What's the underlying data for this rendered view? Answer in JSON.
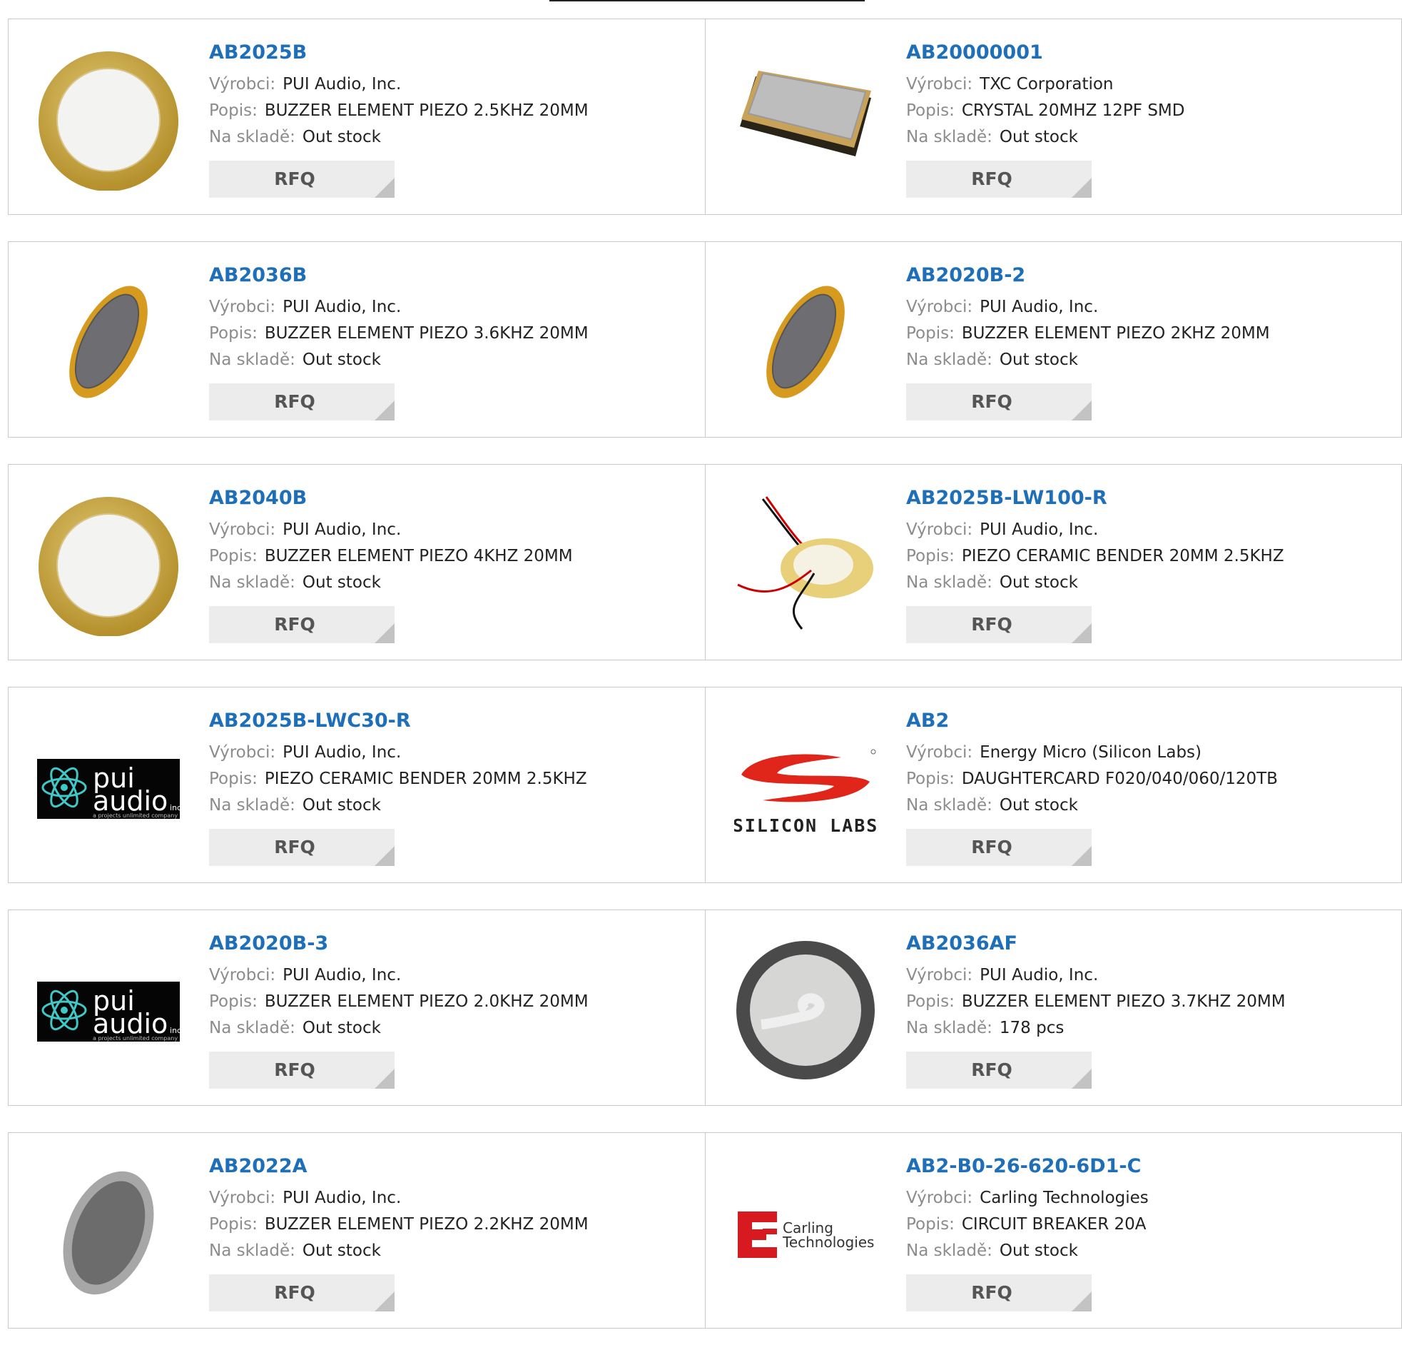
{
  "labels": {
    "maker": "Výrobci:",
    "desc": "Popis:",
    "stock": "Na skladě:",
    "rfq": "RFQ"
  },
  "products": [
    {
      "pn": "AB2025B",
      "maker": "PUI Audio, Inc.",
      "desc": "BUZZER ELEMENT PIEZO 2.5KHZ 20MM",
      "stock": "Out stock",
      "image": "piezo-disc-gold-icon"
    },
    {
      "pn": "AB20000001",
      "maker": "TXC Corporation",
      "desc": "CRYSTAL 20MHZ 12PF SMD",
      "stock": "Out stock",
      "image": "smd-crystal-icon"
    },
    {
      "pn": "AB2036B",
      "maker": "PUI Audio, Inc.",
      "desc": "BUZZER ELEMENT PIEZO 3.6KHZ 20MM",
      "stock": "Out stock",
      "image": "piezo-disc-tilted-icon"
    },
    {
      "pn": "AB2020B-2",
      "maker": "PUI Audio, Inc.",
      "desc": "BUZZER ELEMENT PIEZO 2KHZ 20MM",
      "stock": "Out stock",
      "image": "piezo-disc-tilted-icon"
    },
    {
      "pn": "AB2040B",
      "maker": "PUI Audio, Inc.",
      "desc": "BUZZER ELEMENT PIEZO 4KHZ 20MM",
      "stock": "Out stock",
      "image": "piezo-disc-gold-icon"
    },
    {
      "pn": "AB2025B-LW100-R",
      "maker": "PUI Audio, Inc.",
      "desc": "PIEZO CERAMIC BENDER 20MM 2.5KHZ",
      "stock": "Out stock",
      "image": "piezo-bender-wires-icon"
    },
    {
      "pn": "AB2025B-LWC30-R",
      "maker": "PUI Audio, Inc.",
      "desc": "PIEZO CERAMIC BENDER 20MM 2.5KHZ",
      "stock": "Out stock",
      "image": "pui-audio-logo"
    },
    {
      "pn": "AB2",
      "maker": "Energy Micro (Silicon Labs)",
      "desc": "DAUGHTERCARD F020/040/060/120TB",
      "stock": "Out stock",
      "image": "silicon-labs-logo"
    },
    {
      "pn": "AB2020B-3",
      "maker": "PUI Audio, Inc.",
      "desc": "BUZZER ELEMENT PIEZO 2.0KHZ 20MM",
      "stock": "Out stock",
      "image": "pui-audio-logo"
    },
    {
      "pn": "AB2036AF",
      "maker": "PUI Audio, Inc.",
      "desc": "BUZZER ELEMENT PIEZO 3.7KHZ 20MM",
      "stock": "178 pcs",
      "image": "piezo-disc-gray-icon"
    },
    {
      "pn": "AB2022A",
      "maker": "PUI Audio, Inc.",
      "desc": "BUZZER ELEMENT PIEZO 2.2KHZ 20MM",
      "stock": "Out stock",
      "image": "piezo-disc-silver-icon"
    },
    {
      "pn": "AB2-B0-26-620-6D1-C",
      "maker": "Carling Technologies",
      "desc": "CIRCUIT BREAKER 20A",
      "stock": "Out stock",
      "image": "carling-technologies-logo"
    }
  ],
  "logos": {
    "pui_line1": "pui",
    "pui_line2": "audio",
    "pui_small": "inc",
    "pui_tagline": "a projects unlimited company",
    "silicon": "SILICON LABS",
    "carling1": "Carling",
    "carling2": "Technologies"
  },
  "colors": {
    "link": "#1e6fb8",
    "rfq_bg": "#ececec",
    "label": "#8c8c8c",
    "border": "#c9c9c9"
  }
}
